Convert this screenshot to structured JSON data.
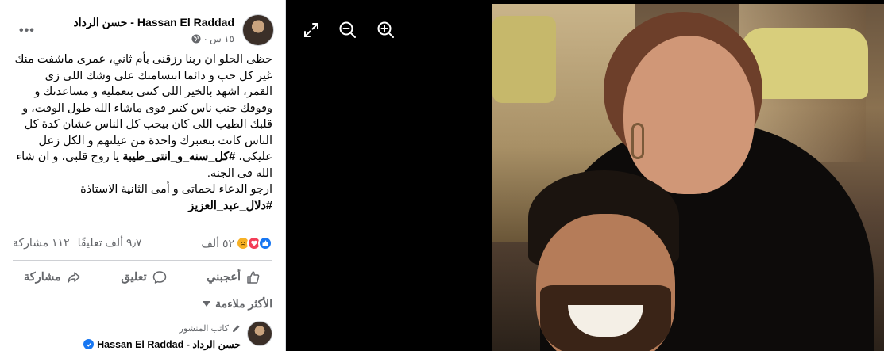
{
  "post": {
    "author": "حسن الرداد - Hassan El Raddad",
    "time": "١٥ س ·",
    "more_label": "•••",
    "body_lines": [
      "حظى الحلو ان ربنا رزقنى بأم ثاني، عمرى ماشفت منك",
      "غير كل حب و دائما ابتسامتك على وشك اللى زى",
      "القمر، اشهد بالخير اللى كنتى بتعمليه و مساعدتك و",
      "وقوفك جنب ناس كتير قوى ماشاء الله طول الوقت، و",
      "قلبك الطيب اللى كان بيحب كل الناس عشان كدة كل",
      "الناس كانت بتعتبرك واحدة من عيلتهم و الكل زعل"
    ],
    "line7_pre": "عليكى، ",
    "line7_tag": "#كل_سنه_و_انتى_طيبة",
    "line7_post": " يا روح قلبى، و ان شاء",
    "line8": "الله فى الجنه.",
    "line9": "ارجو الدعاء لحماتى و أمى الثانية الاستاذة",
    "hashtag2": "#دلال_عبد_العزيز"
  },
  "stats": {
    "reactions": "٥٢ ألف",
    "comments": "٩٫٧ ألف تعليقًا",
    "shares": "١١٢ مشاركة"
  },
  "actions": {
    "like": "أعجبني",
    "comment": "تعليق",
    "share": "مشاركة"
  },
  "sort_label": "الأكثر ملاءمة",
  "comment": {
    "badge": "كاتب المنشور",
    "author": "حسن الرداد - Hassan El Raddad"
  },
  "colors": {
    "accent": "#1877f2",
    "muted": "#65676b",
    "viewer_bg": "#000000"
  }
}
